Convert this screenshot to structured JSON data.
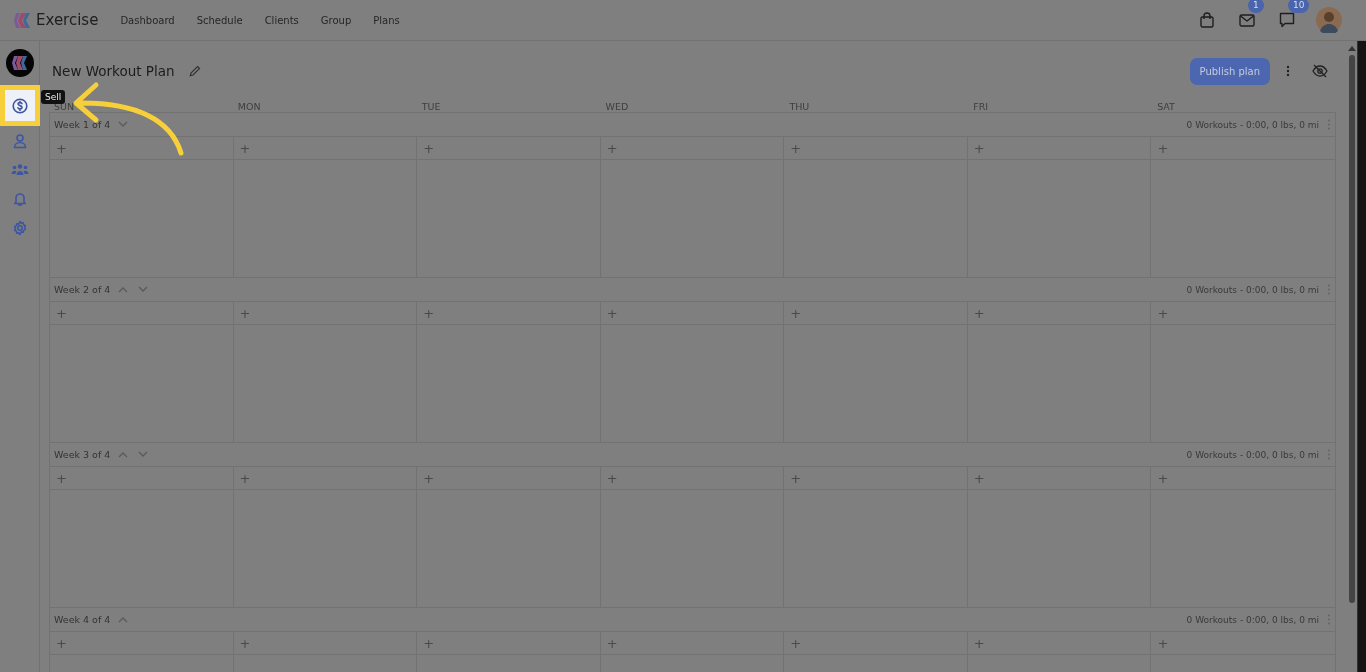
{
  "app": {
    "name": "Exercise"
  },
  "nav": [
    {
      "label": "Dashboard",
      "selected": false
    },
    {
      "label": "Schedule",
      "selected": false
    },
    {
      "label": "Clients",
      "selected": false
    },
    {
      "label": "Group",
      "selected": false
    },
    {
      "label": "Plans",
      "selected": false
    }
  ],
  "header_icons": [
    {
      "kind": "bag"
    },
    {
      "kind": "mail",
      "badge": "1"
    },
    {
      "kind": "chat",
      "badge": "10"
    }
  ],
  "sidebar": {
    "items": [
      {
        "kind": "sell",
        "highlighted": true,
        "tooltip": "Sell"
      },
      {
        "kind": "person",
        "highlighted": false
      },
      {
        "kind": "group",
        "highlighted": false
      },
      {
        "kind": "bell",
        "highlighted": false
      },
      {
        "kind": "gear",
        "highlighted": false
      }
    ]
  },
  "plan": {
    "title": "New Workout Plan",
    "publish_button": "Publish plan"
  },
  "days": [
    "SUN",
    "MON",
    "TUE",
    "WED",
    "THU",
    "FRI",
    "SAT"
  ],
  "weeks": [
    {
      "label": "Week 1 of 4",
      "can_move_up": false,
      "can_move_down": true,
      "summary": "0 Workouts - 0:00, 0 lbs, 0 mi",
      "add_buttons": [
        "+",
        "+",
        "+",
        "+",
        "+",
        "+",
        "+"
      ]
    },
    {
      "label": "Week 2 of 4",
      "can_move_up": true,
      "can_move_down": true,
      "summary": "0 Workouts - 0:00, 0 lbs, 0 mi",
      "add_buttons": [
        "+",
        "+",
        "+",
        "+",
        "+",
        "+",
        "+"
      ]
    },
    {
      "label": "Week 3 of 4",
      "can_move_up": true,
      "can_move_down": true,
      "summary": "0 Workouts - 0:00, 0 lbs, 0 mi",
      "add_buttons": [
        "+",
        "+",
        "+",
        "+",
        "+",
        "+",
        "+"
      ]
    },
    {
      "label": "Week 4 of 4",
      "can_move_up": true,
      "can_move_down": false,
      "summary": "0 Workouts - 0:00, 0 lbs, 0 mi",
      "add_buttons": [
        "+",
        "+",
        "+",
        "+",
        "+",
        "+",
        "+"
      ]
    }
  ]
}
